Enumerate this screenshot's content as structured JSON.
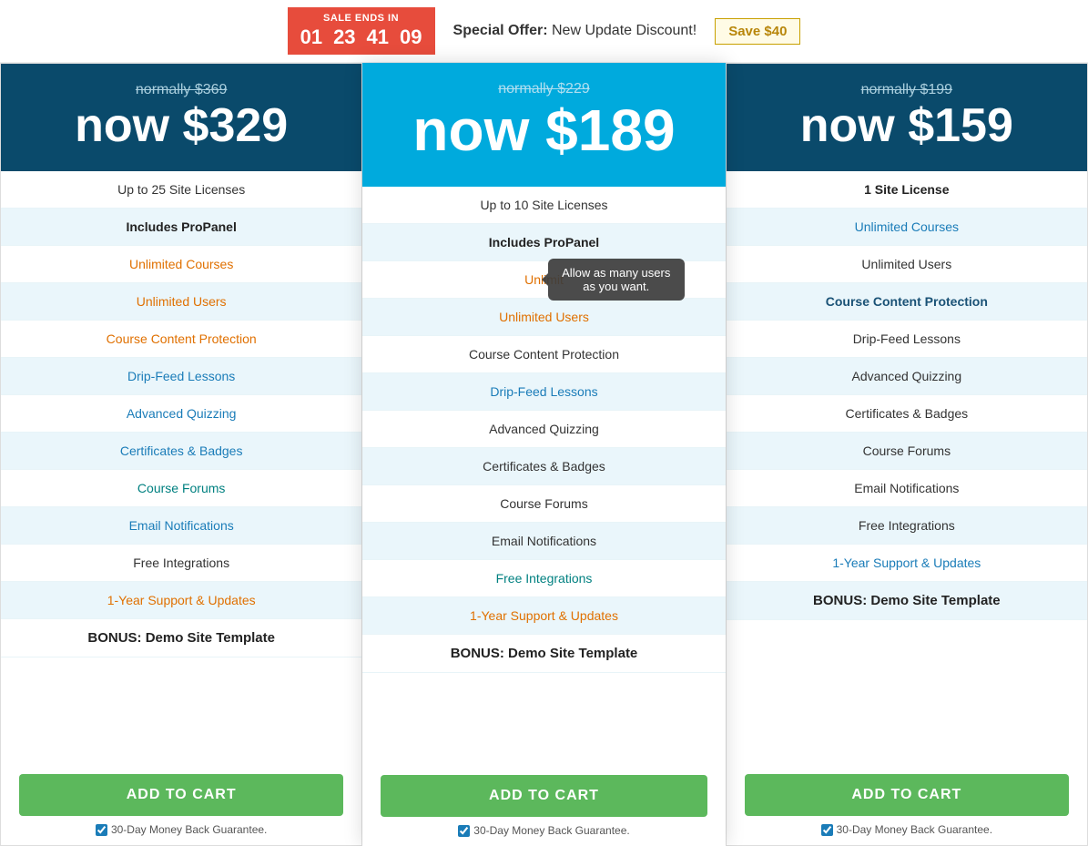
{
  "topbar": {
    "sale_label": "SALE ENDS IN",
    "countdown": [
      "01",
      "23",
      "41",
      "09"
    ],
    "special_offer_text": "Special Offer: New Update Discount!",
    "save_btn_label": "Save $40"
  },
  "plans": [
    {
      "id": "plan-25",
      "original_price": "normally $369",
      "now_price": "now $329",
      "features": [
        {
          "text": "Up to 25 Site Licenses",
          "style": "normal"
        },
        {
          "text": "Includes ProPanel",
          "style": "bold-dark"
        },
        {
          "text": "Unlimited Courses",
          "style": "orange"
        },
        {
          "text": "Unlimited Users",
          "style": "orange"
        },
        {
          "text": "Course Content Protection",
          "style": "orange"
        },
        {
          "text": "Drip-Feed Lessons",
          "style": "blue-link"
        },
        {
          "text": "Advanced Quizzing",
          "style": "blue-link"
        },
        {
          "text": "Certificates & Badges",
          "style": "blue-link"
        },
        {
          "text": "Course Forums",
          "style": "teal"
        },
        {
          "text": "Email Notifications",
          "style": "blue-link"
        },
        {
          "text": "Free Integrations",
          "style": "normal"
        },
        {
          "text": "1-Year Support & Updates",
          "style": "orange"
        },
        {
          "text": "BONUS: Demo Site Template",
          "style": "bold"
        }
      ],
      "button_label": "ADD TO CART",
      "guarantee_text": "30-Day Money Back Guarantee."
    },
    {
      "id": "plan-10",
      "original_price": "normally $229",
      "now_price": "now $189",
      "features": [
        {
          "text": "Up to 10 Site Licenses",
          "style": "normal"
        },
        {
          "text": "Includes ProPanel",
          "style": "bold-dark"
        },
        {
          "text": "Unlimited Courses",
          "style": "orange",
          "tooltip": "Allow as many users as you want."
        },
        {
          "text": "Unlimited Users",
          "style": "orange"
        },
        {
          "text": "Course Content Protection",
          "style": "normal"
        },
        {
          "text": "Drip-Feed Lessons",
          "style": "blue-link"
        },
        {
          "text": "Advanced Quizzing",
          "style": "normal"
        },
        {
          "text": "Certificates & Badges",
          "style": "normal"
        },
        {
          "text": "Course Forums",
          "style": "normal"
        },
        {
          "text": "Email Notifications",
          "style": "normal"
        },
        {
          "text": "Free Integrations",
          "style": "teal"
        },
        {
          "text": "1-Year Support & Updates",
          "style": "orange"
        },
        {
          "text": "BONUS: Demo Site Template",
          "style": "bold"
        }
      ],
      "button_label": "ADD TO CART",
      "guarantee_text": "30-Day Money Back Guarantee.",
      "featured": true
    },
    {
      "id": "plan-1",
      "original_price": "normally $199",
      "now_price": "now $159",
      "features": [
        {
          "text": "1 Site License",
          "style": "bold-dark"
        },
        {
          "text": "Unlimited Courses",
          "style": "blue-link"
        },
        {
          "text": "Unlimited Users",
          "style": "normal"
        },
        {
          "text": "Course Content Protection",
          "style": "dark-blue"
        },
        {
          "text": "Drip-Feed Lessons",
          "style": "normal"
        },
        {
          "text": "Advanced Quizzing",
          "style": "normal"
        },
        {
          "text": "Certificates & Badges",
          "style": "normal"
        },
        {
          "text": "Course Forums",
          "style": "normal"
        },
        {
          "text": "Email Notifications",
          "style": "normal"
        },
        {
          "text": "Free Integrations",
          "style": "normal"
        },
        {
          "text": "1-Year Support & Updates",
          "style": "blue-link"
        },
        {
          "text": "BONUS: Demo Site Template",
          "style": "bold"
        }
      ],
      "button_label": "ADD TO CART",
      "guarantee_text": "30-Day Money Back Guarantee."
    }
  ],
  "tooltip": {
    "text": "Allow as many users as you want."
  }
}
